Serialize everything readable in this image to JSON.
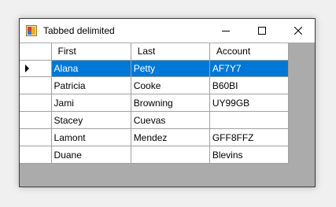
{
  "window": {
    "title": "Tabbed delimited",
    "buttons": [
      "minimize",
      "maximize",
      "close"
    ]
  },
  "grid": {
    "columns": [
      "First",
      "Last",
      "Account"
    ],
    "selected_row": 0,
    "rows": [
      {
        "first": "Alana",
        "last": "Petty",
        "account": "AF7Y7"
      },
      {
        "first": "Patricia",
        "last": "Cooke",
        "account": "B60BI"
      },
      {
        "first": "Jami",
        "last": "Browning",
        "account": "UY99GB"
      },
      {
        "first": "Stacey",
        "last": "Cuevas",
        "account": ""
      },
      {
        "first": "Lamont",
        "last": "Mendez",
        "account": "GFF8FFZ"
      },
      {
        "first": "Duane",
        "last": "",
        "account": "Blevins"
      }
    ]
  },
  "colors": {
    "selection": "#0078d7",
    "grid_background": "#ababab",
    "gridline": "#a0a0a0"
  }
}
